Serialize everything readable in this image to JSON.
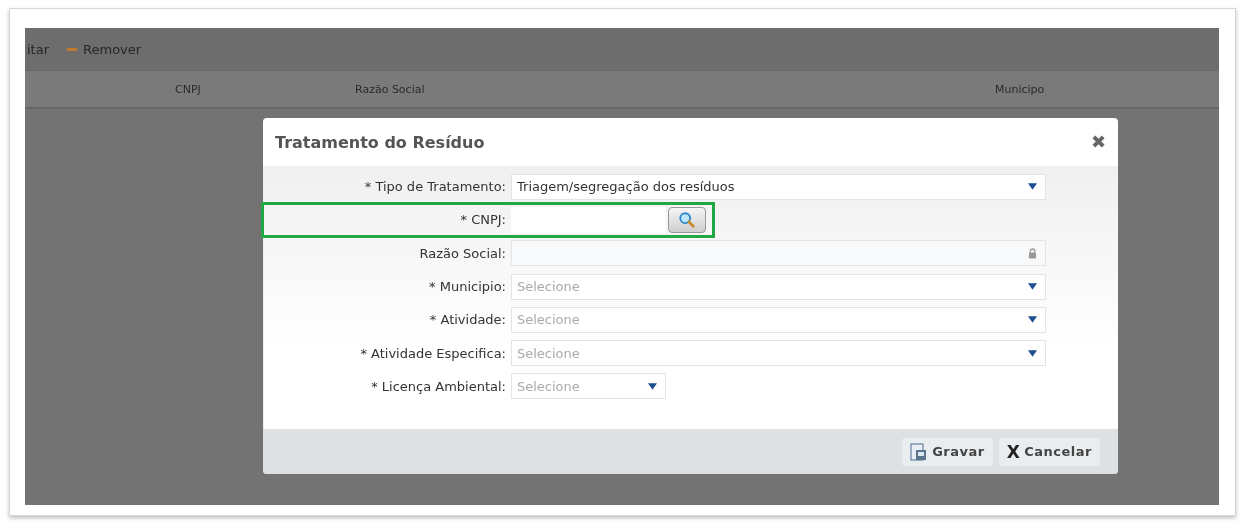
{
  "toolbar": {
    "items": [
      {
        "label": "itar",
        "kind": "text"
      },
      {
        "label": "Remover",
        "kind": "remove"
      }
    ]
  },
  "table": {
    "columns": [
      "CNPJ",
      "Razão Social",
      "Municipo"
    ]
  },
  "dialog": {
    "title": "Tratamento do Resíduo",
    "close": "✖",
    "fields": [
      {
        "label": "* Tipo de Tratamento:",
        "kind": "select",
        "value": "Triagem/segregação dos resíduos",
        "short": false,
        "highlighted": false
      },
      {
        "label": "* CNPJ:",
        "kind": "lookup",
        "short": true,
        "highlighted": true
      },
      {
        "label": "Razão Social:",
        "kind": "readonly",
        "short": false,
        "highlighted": false
      },
      {
        "label": "* Municipio:",
        "kind": "select",
        "placeholder": "Selecione",
        "short": false,
        "highlighted": false
      },
      {
        "label": "* Atividade:",
        "kind": "select",
        "placeholder": "Selecione",
        "short": false,
        "highlighted": false
      },
      {
        "label": "* Atividade Especifica:",
        "kind": "select",
        "placeholder": "Selecione",
        "short": false,
        "highlighted": false
      },
      {
        "label": "* Licença Ambiental:",
        "kind": "select",
        "placeholder": "Selecione",
        "short": true,
        "highlighted": false
      }
    ],
    "buttons": [
      {
        "label": "Gravar",
        "kind": "save"
      },
      {
        "label": "X",
        "kind": "cancel-icon"
      },
      {
        "label": "Cancelar",
        "kind": "cancel"
      }
    ]
  }
}
